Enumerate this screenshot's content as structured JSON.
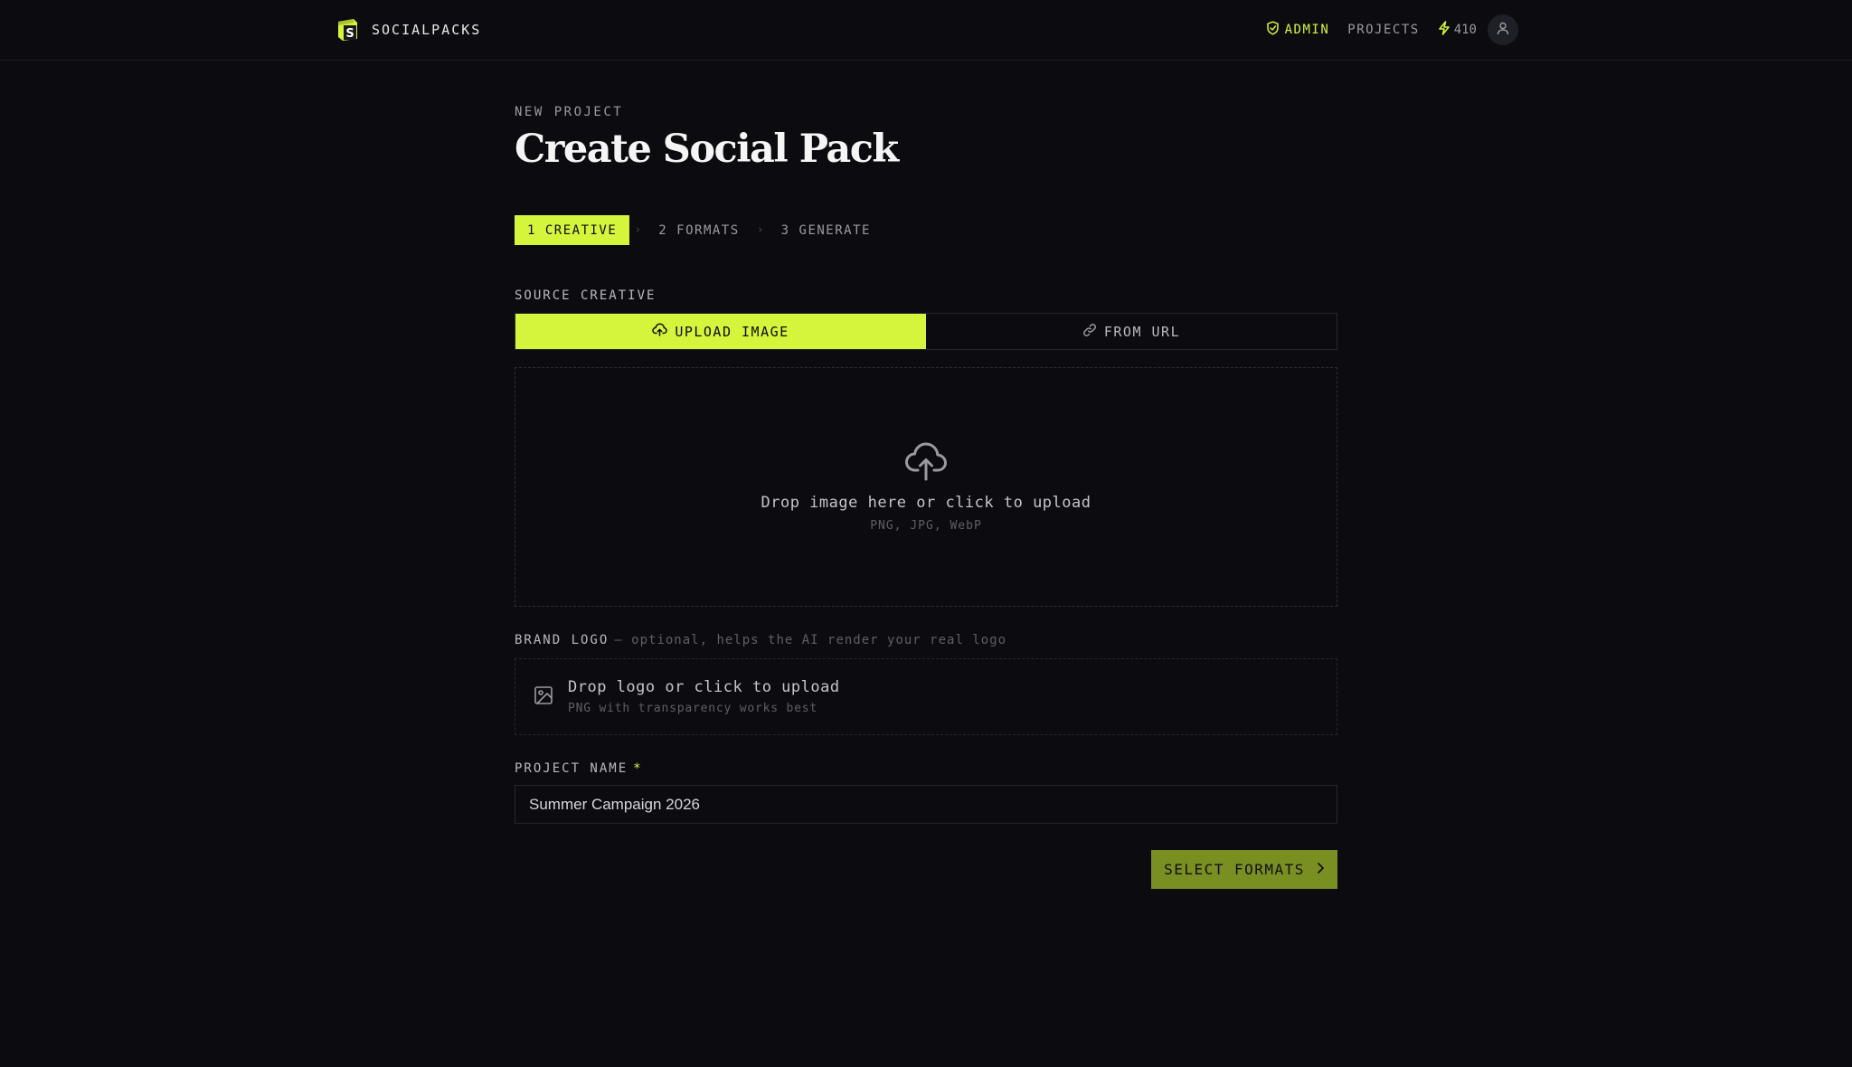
{
  "header": {
    "brand_name": "SOCIALPACKS",
    "admin_label": "ADMIN",
    "projects_label": "PROJECTS",
    "credits": "410"
  },
  "page": {
    "eyebrow": "NEW PROJECT",
    "title": "Create Social Pack"
  },
  "steps": [
    {
      "label": "1 CREATIVE",
      "active": true
    },
    {
      "label": "2 FORMATS",
      "active": false
    },
    {
      "label": "3 GENERATE",
      "active": false
    }
  ],
  "source": {
    "label": "SOURCE CREATIVE",
    "tabs": [
      {
        "label": "UPLOAD IMAGE",
        "icon": "cloud-upload-icon",
        "active": true
      },
      {
        "label": "FROM URL",
        "icon": "link-icon",
        "active": false
      }
    ],
    "dropzone": {
      "title": "Drop image here or click to upload",
      "formats": "PNG, JPG, WebP"
    }
  },
  "brand_logo": {
    "label": "BRAND LOGO",
    "hint": "— optional, helps the AI render your real logo",
    "title": "Drop logo or click to upload",
    "subtitle": "PNG with transparency works best"
  },
  "project_name": {
    "label": "PROJECT NAME",
    "required_mark": "*",
    "value": "Summer Campaign 2026"
  },
  "cta": {
    "label": "SELECT FORMATS"
  },
  "colors": {
    "accent": "#d4f53c",
    "background": "#0c0c10",
    "cta_background": "#7a8f22"
  }
}
